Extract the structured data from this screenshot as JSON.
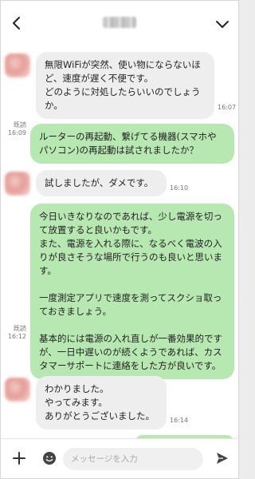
{
  "header": {
    "back_icon": "chevron-left-icon",
    "menu_icon": "chevron-down-icon"
  },
  "messages": [
    {
      "sender": "other",
      "text": "無限WiFiが突然、使い物にならないほど、速度が遅く不便です。\nどのように対処したらいいのでしょうか。",
      "time": "16:07"
    },
    {
      "sender": "me",
      "text": "ルーターの再起動、繋げてる機器(スマホやパソコン)の再起動は試されましたか？",
      "read": "既読",
      "time": "16:09"
    },
    {
      "sender": "other",
      "text": "試しましたが、ダメです。",
      "time": "16:10"
    },
    {
      "sender": "me",
      "text": "今日いきなりなのであれば、少し電源を切って放置すると良いかもです。\nまた、電源を入れる際に、なるべく電波の入りが良さそうな場所で行うのも良いと思います。\n\n一度測定アプリで速度を測ってスクショ取っておきましょう。\n\n基本的には電源の入れ直しが一番効果的ですが、一日中遅いのが続くようであれば、カスタマーサポートに連絡をした方が良いです。",
      "read": "既読",
      "time": "16:12"
    },
    {
      "sender": "other",
      "text": "わかりました。\nやってみます。\nありがとうございました。",
      "time": "16:14"
    }
  ],
  "input": {
    "placeholder": "メッセージを入力",
    "value": ""
  },
  "colors": {
    "incoming_bubble": "#eeeeee",
    "outgoing_bubble": "#b7e8b1"
  }
}
